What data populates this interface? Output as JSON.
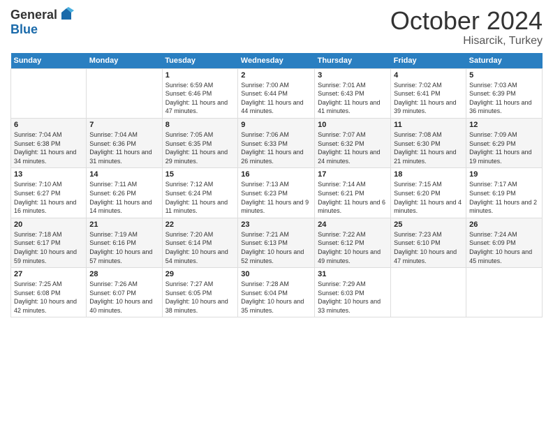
{
  "logo": {
    "general": "General",
    "blue": "Blue"
  },
  "title": {
    "month": "October 2024",
    "location": "Hisarcik, Turkey"
  },
  "weekdays": [
    "Sunday",
    "Monday",
    "Tuesday",
    "Wednesday",
    "Thursday",
    "Friday",
    "Saturday"
  ],
  "weeks": [
    [
      {
        "day": "",
        "sunrise": "",
        "sunset": "",
        "daylight": ""
      },
      {
        "day": "",
        "sunrise": "",
        "sunset": "",
        "daylight": ""
      },
      {
        "day": "1",
        "sunrise": "Sunrise: 6:59 AM",
        "sunset": "Sunset: 6:46 PM",
        "daylight": "Daylight: 11 hours and 47 minutes."
      },
      {
        "day": "2",
        "sunrise": "Sunrise: 7:00 AM",
        "sunset": "Sunset: 6:44 PM",
        "daylight": "Daylight: 11 hours and 44 minutes."
      },
      {
        "day": "3",
        "sunrise": "Sunrise: 7:01 AM",
        "sunset": "Sunset: 6:43 PM",
        "daylight": "Daylight: 11 hours and 41 minutes."
      },
      {
        "day": "4",
        "sunrise": "Sunrise: 7:02 AM",
        "sunset": "Sunset: 6:41 PM",
        "daylight": "Daylight: 11 hours and 39 minutes."
      },
      {
        "day": "5",
        "sunrise": "Sunrise: 7:03 AM",
        "sunset": "Sunset: 6:39 PM",
        "daylight": "Daylight: 11 hours and 36 minutes."
      }
    ],
    [
      {
        "day": "6",
        "sunrise": "Sunrise: 7:04 AM",
        "sunset": "Sunset: 6:38 PM",
        "daylight": "Daylight: 11 hours and 34 minutes."
      },
      {
        "day": "7",
        "sunrise": "Sunrise: 7:04 AM",
        "sunset": "Sunset: 6:36 PM",
        "daylight": "Daylight: 11 hours and 31 minutes."
      },
      {
        "day": "8",
        "sunrise": "Sunrise: 7:05 AM",
        "sunset": "Sunset: 6:35 PM",
        "daylight": "Daylight: 11 hours and 29 minutes."
      },
      {
        "day": "9",
        "sunrise": "Sunrise: 7:06 AM",
        "sunset": "Sunset: 6:33 PM",
        "daylight": "Daylight: 11 hours and 26 minutes."
      },
      {
        "day": "10",
        "sunrise": "Sunrise: 7:07 AM",
        "sunset": "Sunset: 6:32 PM",
        "daylight": "Daylight: 11 hours and 24 minutes."
      },
      {
        "day": "11",
        "sunrise": "Sunrise: 7:08 AM",
        "sunset": "Sunset: 6:30 PM",
        "daylight": "Daylight: 11 hours and 21 minutes."
      },
      {
        "day": "12",
        "sunrise": "Sunrise: 7:09 AM",
        "sunset": "Sunset: 6:29 PM",
        "daylight": "Daylight: 11 hours and 19 minutes."
      }
    ],
    [
      {
        "day": "13",
        "sunrise": "Sunrise: 7:10 AM",
        "sunset": "Sunset: 6:27 PM",
        "daylight": "Daylight: 11 hours and 16 minutes."
      },
      {
        "day": "14",
        "sunrise": "Sunrise: 7:11 AM",
        "sunset": "Sunset: 6:26 PM",
        "daylight": "Daylight: 11 hours and 14 minutes."
      },
      {
        "day": "15",
        "sunrise": "Sunrise: 7:12 AM",
        "sunset": "Sunset: 6:24 PM",
        "daylight": "Daylight: 11 hours and 11 minutes."
      },
      {
        "day": "16",
        "sunrise": "Sunrise: 7:13 AM",
        "sunset": "Sunset: 6:23 PM",
        "daylight": "Daylight: 11 hours and 9 minutes."
      },
      {
        "day": "17",
        "sunrise": "Sunrise: 7:14 AM",
        "sunset": "Sunset: 6:21 PM",
        "daylight": "Daylight: 11 hours and 6 minutes."
      },
      {
        "day": "18",
        "sunrise": "Sunrise: 7:15 AM",
        "sunset": "Sunset: 6:20 PM",
        "daylight": "Daylight: 11 hours and 4 minutes."
      },
      {
        "day": "19",
        "sunrise": "Sunrise: 7:17 AM",
        "sunset": "Sunset: 6:19 PM",
        "daylight": "Daylight: 11 hours and 2 minutes."
      }
    ],
    [
      {
        "day": "20",
        "sunrise": "Sunrise: 7:18 AM",
        "sunset": "Sunset: 6:17 PM",
        "daylight": "Daylight: 10 hours and 59 minutes."
      },
      {
        "day": "21",
        "sunrise": "Sunrise: 7:19 AM",
        "sunset": "Sunset: 6:16 PM",
        "daylight": "Daylight: 10 hours and 57 minutes."
      },
      {
        "day": "22",
        "sunrise": "Sunrise: 7:20 AM",
        "sunset": "Sunset: 6:14 PM",
        "daylight": "Daylight: 10 hours and 54 minutes."
      },
      {
        "day": "23",
        "sunrise": "Sunrise: 7:21 AM",
        "sunset": "Sunset: 6:13 PM",
        "daylight": "Daylight: 10 hours and 52 minutes."
      },
      {
        "day": "24",
        "sunrise": "Sunrise: 7:22 AM",
        "sunset": "Sunset: 6:12 PM",
        "daylight": "Daylight: 10 hours and 49 minutes."
      },
      {
        "day": "25",
        "sunrise": "Sunrise: 7:23 AM",
        "sunset": "Sunset: 6:10 PM",
        "daylight": "Daylight: 10 hours and 47 minutes."
      },
      {
        "day": "26",
        "sunrise": "Sunrise: 7:24 AM",
        "sunset": "Sunset: 6:09 PM",
        "daylight": "Daylight: 10 hours and 45 minutes."
      }
    ],
    [
      {
        "day": "27",
        "sunrise": "Sunrise: 7:25 AM",
        "sunset": "Sunset: 6:08 PM",
        "daylight": "Daylight: 10 hours and 42 minutes."
      },
      {
        "day": "28",
        "sunrise": "Sunrise: 7:26 AM",
        "sunset": "Sunset: 6:07 PM",
        "daylight": "Daylight: 10 hours and 40 minutes."
      },
      {
        "day": "29",
        "sunrise": "Sunrise: 7:27 AM",
        "sunset": "Sunset: 6:05 PM",
        "daylight": "Daylight: 10 hours and 38 minutes."
      },
      {
        "day": "30",
        "sunrise": "Sunrise: 7:28 AM",
        "sunset": "Sunset: 6:04 PM",
        "daylight": "Daylight: 10 hours and 35 minutes."
      },
      {
        "day": "31",
        "sunrise": "Sunrise: 7:29 AM",
        "sunset": "Sunset: 6:03 PM",
        "daylight": "Daylight: 10 hours and 33 minutes."
      },
      {
        "day": "",
        "sunrise": "",
        "sunset": "",
        "daylight": ""
      },
      {
        "day": "",
        "sunrise": "",
        "sunset": "",
        "daylight": ""
      }
    ]
  ]
}
